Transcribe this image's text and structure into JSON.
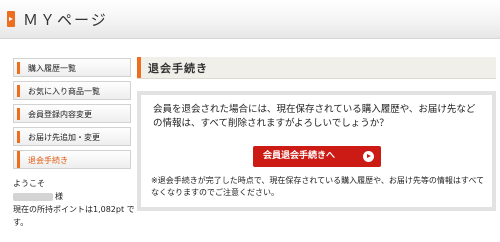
{
  "header": {
    "title": "ＭＹページ"
  },
  "sidebar": {
    "items": [
      {
        "label": "購入履歴一覧"
      },
      {
        "label": "お気に入り商品一覧"
      },
      {
        "label": "会員登録内容変更"
      },
      {
        "label": "お届け先追加・変更"
      },
      {
        "label": "退会手続き"
      }
    ]
  },
  "welcome": {
    "greeting": "ようこそ",
    "honorific": "様",
    "points_line": "現在の所持ポイントは1,082pt で",
    "points_line2": "す。"
  },
  "main": {
    "heading": "退会手続き",
    "message": "会員を退会された場合には、現在保存されている購入履歴や、お届け先などの情報は、すべて削除されますがよろしいでしょうか？",
    "button_label": "会員退会手続きへ",
    "note": "※退会手続きが完了した時点で、現在保存されている購入履歴や、お届け先等の情報はすべてなくなりますのでご注意ください。"
  },
  "colors": {
    "accent": "#ee6e1f",
    "button": "#cc1a14"
  }
}
